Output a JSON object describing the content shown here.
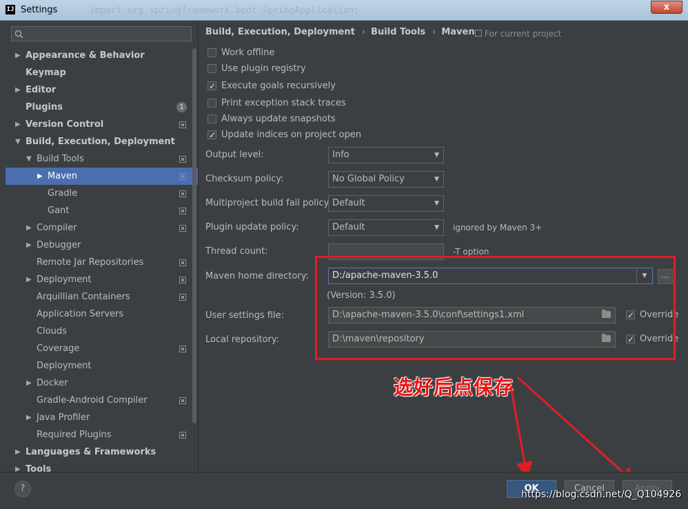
{
  "window": {
    "title": "Settings",
    "bg_code": "import org.springframework.boot.SpringApplication;",
    "close_label": "x"
  },
  "sidebar": {
    "search_placeholder": "",
    "items": [
      {
        "label": "Appearance & Behavior",
        "bold": true,
        "level": 0,
        "arrow": "▶",
        "icon": ""
      },
      {
        "label": "Keymap",
        "bold": true,
        "level": 0,
        "arrow": "",
        "icon": ""
      },
      {
        "label": "Editor",
        "bold": true,
        "level": 0,
        "arrow": "▶",
        "icon": ""
      },
      {
        "label": "Plugins",
        "bold": true,
        "level": 0,
        "arrow": "",
        "icon": "",
        "badge": "1"
      },
      {
        "label": "Version Control",
        "bold": true,
        "level": 0,
        "arrow": "▶",
        "icon": "project"
      },
      {
        "label": "Build, Execution, Deployment",
        "bold": true,
        "level": 0,
        "arrow": "▼",
        "icon": ""
      },
      {
        "label": "Build Tools",
        "bold": false,
        "level": 1,
        "arrow": "▼",
        "icon": "project"
      },
      {
        "label": "Maven",
        "bold": false,
        "level": 2,
        "arrow": "▶",
        "icon": "project",
        "selected": true
      },
      {
        "label": "Gradle",
        "bold": false,
        "level": 2,
        "arrow": "",
        "icon": "project"
      },
      {
        "label": "Gant",
        "bold": false,
        "level": 2,
        "arrow": "",
        "icon": "project"
      },
      {
        "label": "Compiler",
        "bold": false,
        "level": 1,
        "arrow": "▶",
        "icon": "project"
      },
      {
        "label": "Debugger",
        "bold": false,
        "level": 1,
        "arrow": "▶",
        "icon": ""
      },
      {
        "label": "Remote Jar Repositories",
        "bold": false,
        "level": 1,
        "arrow": "",
        "icon": "project"
      },
      {
        "label": "Deployment",
        "bold": false,
        "level": 1,
        "arrow": "▶",
        "icon": "project"
      },
      {
        "label": "Arquillian Containers",
        "bold": false,
        "level": 1,
        "arrow": "",
        "icon": "project"
      },
      {
        "label": "Application Servers",
        "bold": false,
        "level": 1,
        "arrow": "",
        "icon": ""
      },
      {
        "label": "Clouds",
        "bold": false,
        "level": 1,
        "arrow": "",
        "icon": ""
      },
      {
        "label": "Coverage",
        "bold": false,
        "level": 1,
        "arrow": "",
        "icon": "project"
      },
      {
        "label": "Deployment",
        "bold": false,
        "level": 1,
        "arrow": "",
        "icon": ""
      },
      {
        "label": "Docker",
        "bold": false,
        "level": 1,
        "arrow": "▶",
        "icon": ""
      },
      {
        "label": "Gradle-Android Compiler",
        "bold": false,
        "level": 1,
        "arrow": "",
        "icon": "project"
      },
      {
        "label": "Java Profiler",
        "bold": false,
        "level": 1,
        "arrow": "▶",
        "icon": ""
      },
      {
        "label": "Required Plugins",
        "bold": false,
        "level": 1,
        "arrow": "",
        "icon": "project"
      },
      {
        "label": "Languages & Frameworks",
        "bold": true,
        "level": 0,
        "arrow": "▶",
        "icon": ""
      },
      {
        "label": "Tools",
        "bold": true,
        "level": 0,
        "arrow": "▶",
        "icon": ""
      }
    ]
  },
  "breadcrumb": [
    "Build, Execution, Deployment",
    "Build Tools",
    "Maven"
  ],
  "breadcrumb_sep": "›",
  "for_project": "For current project",
  "checkboxes": [
    {
      "label": "Work offline",
      "checked": false
    },
    {
      "label": "Use plugin registry",
      "checked": false
    },
    {
      "label": "Execute goals recursively",
      "checked": true
    },
    {
      "label": "Print exception stack traces",
      "checked": false
    },
    {
      "label": "Always update snapshots",
      "checked": false
    },
    {
      "label": "Update indices on project open",
      "checked": true
    }
  ],
  "fields": {
    "output_level": {
      "label": "Output level:",
      "value": "Info"
    },
    "checksum_policy": {
      "label": "Checksum policy:",
      "value": "No Global Policy"
    },
    "multiproject_policy": {
      "label": "Multiproject build fail policy:",
      "value": "Default"
    },
    "plugin_update_policy": {
      "label": "Plugin update policy:",
      "value": "Default",
      "note": "ignored by Maven 3+"
    },
    "thread_count": {
      "label": "Thread count:",
      "value": "",
      "note": "-T option"
    },
    "maven_home": {
      "label": "Maven home directory:",
      "value": "D:/apache-maven-3.5.0",
      "version": "(Version: 3.5.0)",
      "browse": "..."
    },
    "user_settings": {
      "label": "User settings file:",
      "value": "D:\\apache-maven-3.5.0\\conf\\settings1.xml",
      "override": "Override"
    },
    "local_repo": {
      "label": "Local repository:",
      "value": "D:\\maven\\repository",
      "override": "Override"
    }
  },
  "annotation": "选好后点保存",
  "buttons": {
    "help": "?",
    "ok": "OK",
    "cancel": "Cancel",
    "apply": "Apply"
  },
  "watermark": "https://blog.csdn.net/Q_Q104926",
  "colors": {
    "selection": "#4b6eaf",
    "annotation_red": "#e01e26",
    "ok_button": "#365880"
  }
}
